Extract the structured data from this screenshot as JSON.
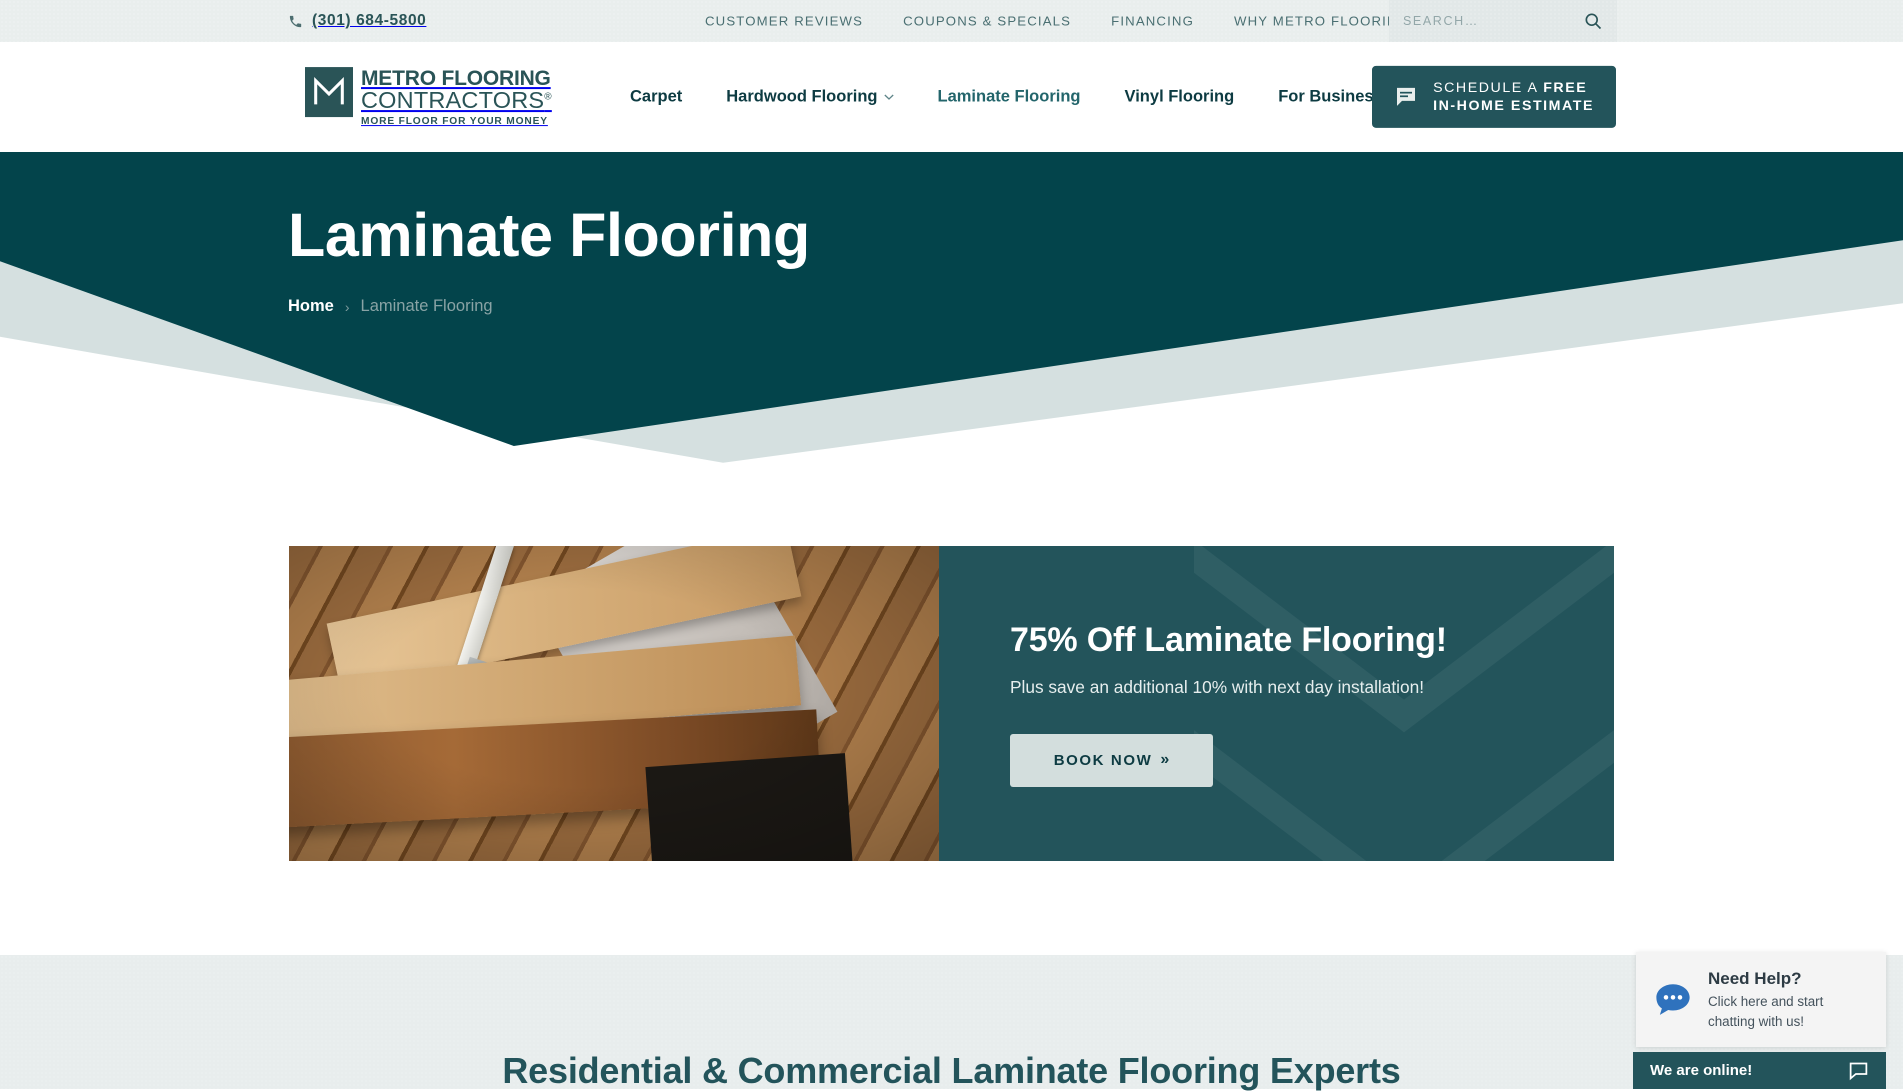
{
  "topbar": {
    "phone": "(301) 684-5800",
    "phone_icon": "phone-icon",
    "links": [
      {
        "label": "CUSTOMER REVIEWS"
      },
      {
        "label": "COUPONS & SPECIALS"
      },
      {
        "label": "FINANCING"
      },
      {
        "label": "WHY METRO FLOORING?"
      }
    ],
    "search": {
      "placeholder": "SEARCH…",
      "value": "",
      "icon": "search-icon"
    }
  },
  "header": {
    "logo": {
      "line1": "METRO FLOORING",
      "line2": "CONTRACTORS",
      "registered": "®",
      "tagline": "MORE FLOOR FOR YOUR MONEY"
    },
    "nav": [
      {
        "label": "Carpet",
        "has_dropdown": false,
        "active": false
      },
      {
        "label": "Hardwood Flooring",
        "has_dropdown": true,
        "active": false
      },
      {
        "label": "Laminate Flooring",
        "has_dropdown": false,
        "active": true
      },
      {
        "label": "Vinyl Flooring",
        "has_dropdown": false,
        "active": false
      },
      {
        "label": "For Business",
        "has_dropdown": true,
        "active": false
      }
    ],
    "cta": {
      "line1_prefix": "SCHEDULE A ",
      "line1_strong": "FREE",
      "line2": "IN-HOME ESTIMATE",
      "icon": "chat-bubble-icon"
    }
  },
  "hero": {
    "title": "Laminate Flooring",
    "breadcrumb": {
      "home": "Home",
      "separator": "›",
      "current": "Laminate Flooring"
    }
  },
  "promo": {
    "heading": "75% Off Laminate Flooring!",
    "subheading": "Plus save an additional 10% with next day installation!",
    "button_label": "BOOK NOW",
    "button_arrow": "»",
    "image_alt": "stacked-laminate-planks-photo"
  },
  "lower": {
    "heading": "Residential & Commercial Laminate Flooring Experts"
  },
  "chat": {
    "heading": "Need Help?",
    "body_line1": "Click here and start",
    "body_line2": "chatting with us!",
    "status": "We are online!",
    "bubble_icon": "chat-bubble-icon",
    "bar_icon": "chat-icon"
  },
  "colors": {
    "hero_teal": "#03444b",
    "brand_teal": "#23545b",
    "nav_dark": "#0d3b42",
    "active_nav": "#23656b",
    "topbar_bg": "#e9eeed",
    "lower_bg": "#e8eded",
    "button_light": "#d3dedd",
    "chat_blue": "#2f72bd"
  }
}
